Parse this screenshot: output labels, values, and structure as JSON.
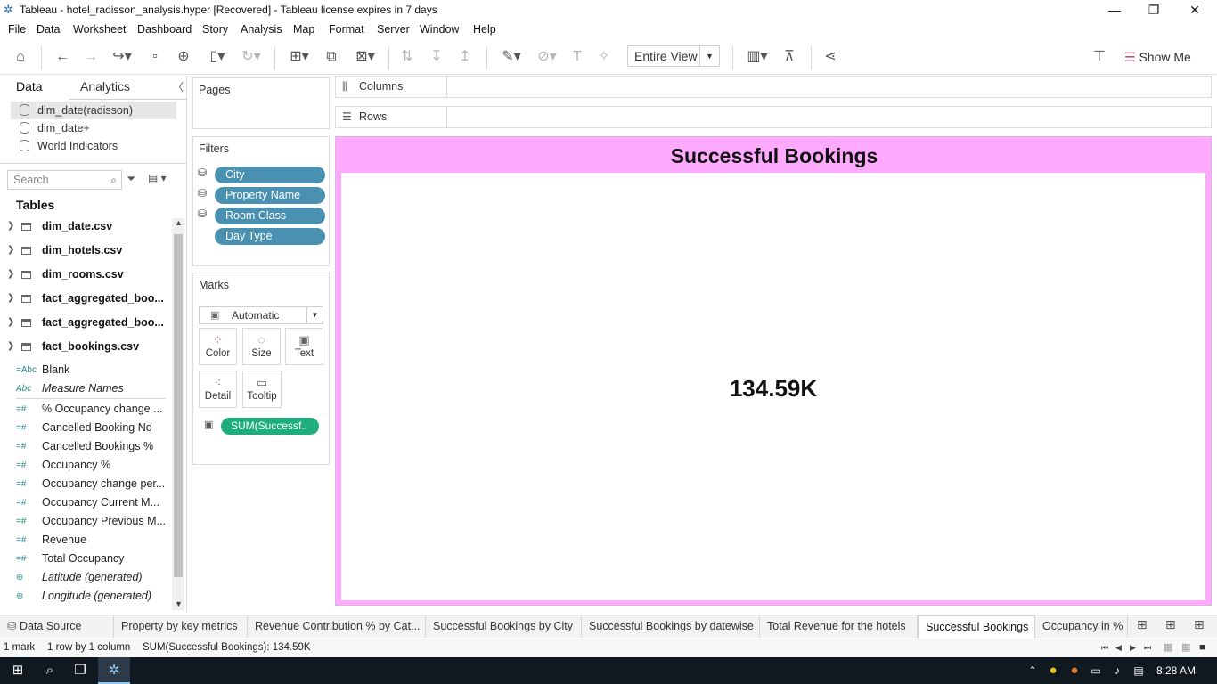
{
  "window": {
    "title": "Tableau - hotel_radisson_analysis.hyper [Recovered] - Tableau license expires in 7 days",
    "minimize": "—",
    "restore": "❐",
    "close": "✕"
  },
  "menu": [
    "File",
    "Data",
    "Worksheet",
    "Dashboard",
    "Story",
    "Analysis",
    "Map",
    "Format",
    "Server",
    "Window",
    "Help"
  ],
  "toolbar": {
    "fit": "Entire View",
    "show_me": "Show Me"
  },
  "datapane": {
    "tab_data": "Data",
    "tab_analytics": "Analytics",
    "datasources": [
      "dim_date(radisson)",
      "dim_date+",
      "World Indicators"
    ],
    "search_placeholder": "Search",
    "tables_header": "Tables",
    "tables": [
      "dim_date.csv",
      "dim_hotels.csv",
      "dim_rooms.csv",
      "fact_aggregated_boo...",
      "fact_aggregated_boo...",
      "fact_bookings.csv"
    ],
    "dimension_fields": [
      {
        "icon": "=Abc",
        "name": "Blank"
      },
      {
        "icon": "Abc",
        "name": "Measure Names"
      }
    ],
    "measure_fields": [
      {
        "icon": "=#",
        "name": "% Occupancy change ..."
      },
      {
        "icon": "=#",
        "name": "Cancelled Booking No"
      },
      {
        "icon": "=#",
        "name": "Cancelled Bookings %"
      },
      {
        "icon": "=#",
        "name": "Occupancy %"
      },
      {
        "icon": "=#",
        "name": "Occupancy change per..."
      },
      {
        "icon": "=#",
        "name": "Occupancy Current M..."
      },
      {
        "icon": "=#",
        "name": "Occupancy Previous M..."
      },
      {
        "icon": "=#",
        "name": "Revenue"
      },
      {
        "icon": "=#",
        "name": "Total Occupancy"
      },
      {
        "icon": "globe",
        "name": "Latitude (generated)"
      },
      {
        "icon": "globe",
        "name": "Longitude (generated)"
      }
    ]
  },
  "pages": {
    "title": "Pages"
  },
  "filters": {
    "title": "Filters",
    "items": [
      "City",
      "Property Name",
      "Room Class",
      "Day Type"
    ]
  },
  "marks": {
    "title": "Marks",
    "type": "Automatic",
    "buttons": [
      "Color",
      "Size",
      "Text",
      "Detail",
      "Tooltip"
    ],
    "pill": "SUM(Successf.."
  },
  "shelves": {
    "columns": "Columns",
    "rows": "Rows"
  },
  "viz": {
    "title": "Successful Bookings",
    "value": "134.59K"
  },
  "sheet_tabs": [
    {
      "label": "Data Source"
    },
    {
      "label": "Property by key metrics"
    },
    {
      "label": "Revenue Contribution % by Cat..."
    },
    {
      "label": "Successful Bookings by City"
    },
    {
      "label": "Successful Bookings by datewise"
    },
    {
      "label": "Total Revenue for the hotels"
    },
    {
      "label": "Successful Bookings",
      "active": true
    },
    {
      "label": "Occupancy in %"
    }
  ],
  "status": {
    "marks": "1 mark",
    "rows": "1 row by 1 column",
    "sum": "SUM(Successful Bookings): 134.59K"
  },
  "taskbar": {
    "clock": "8:28 AM"
  }
}
